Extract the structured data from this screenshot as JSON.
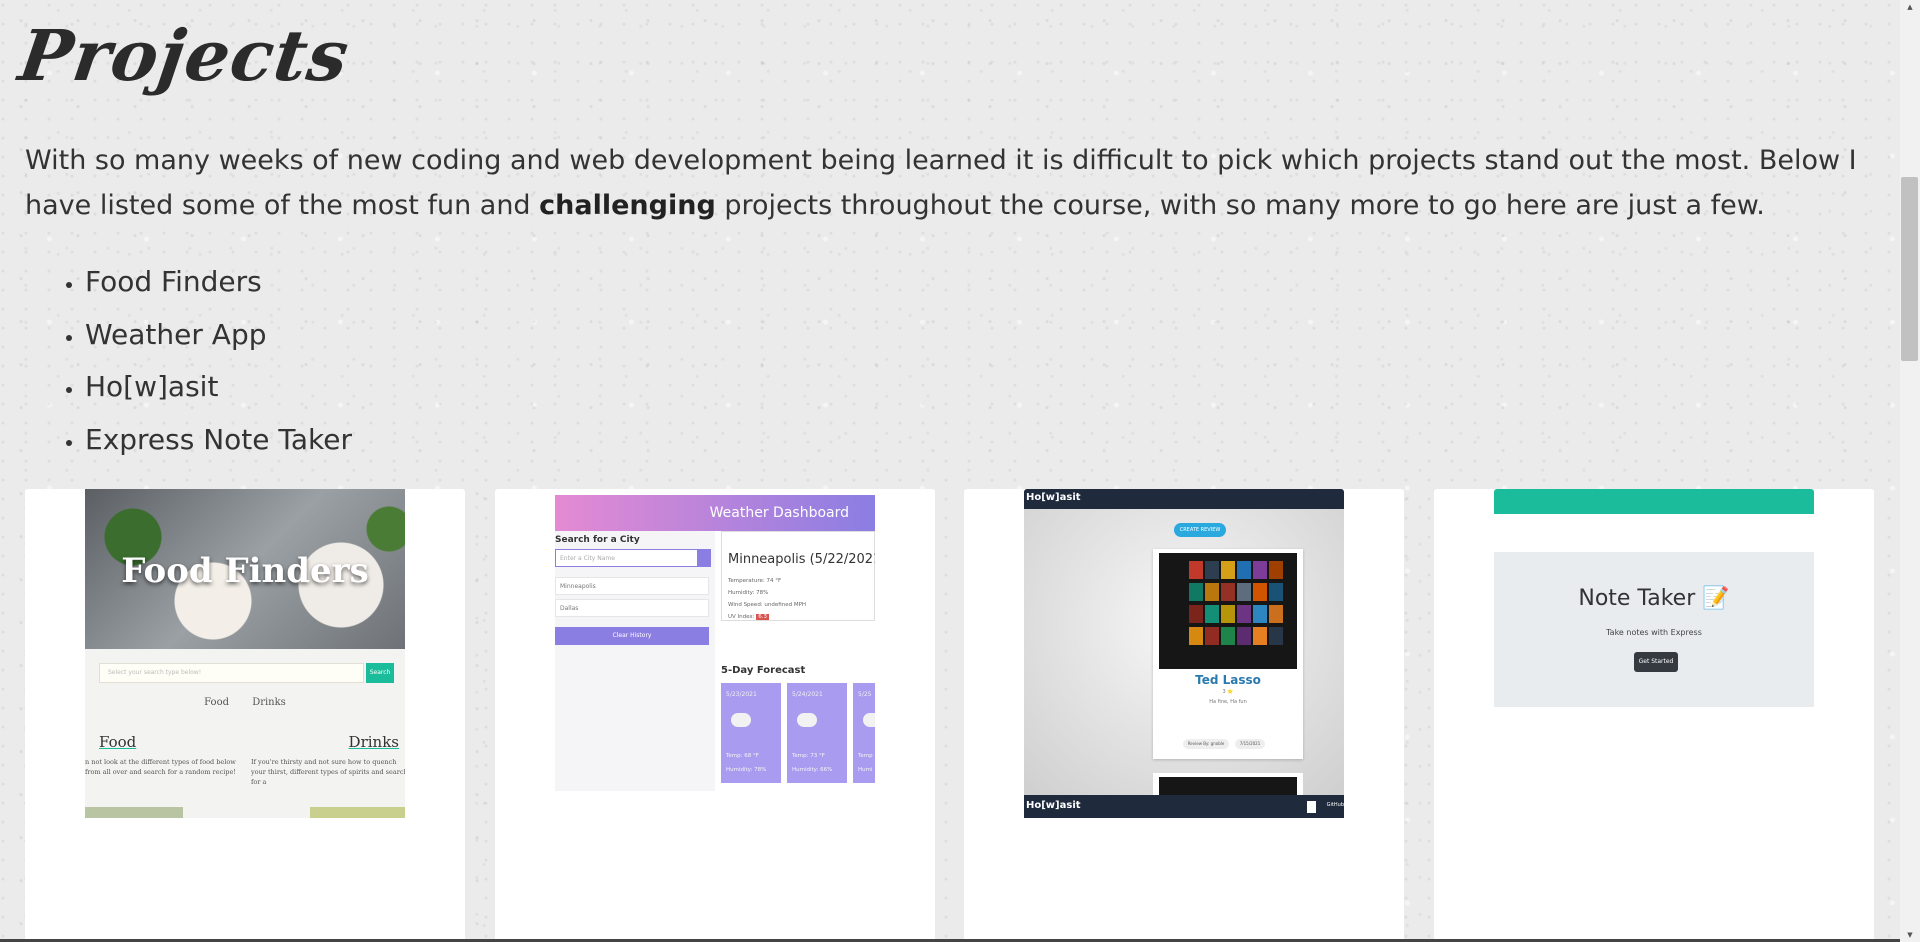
{
  "page": {
    "title": "Projects",
    "intro_before": "With so many weeks of new coding and web development being learned it is difficult to pick which projects stand out the most. Below I have listed some of the most fun and ",
    "intro_bold": "challenging",
    "intro_after": " projects throughout the course, with so many more to go here are just a few."
  },
  "projects": [
    "Food Finders",
    "Weather App",
    "Ho[w]asit",
    "Express Note Taker"
  ],
  "cards": {
    "food_finders": {
      "hero_title": "Food Finders",
      "search_placeholder": "Select your search type below!",
      "search_button": "Search",
      "nav_food": "Food",
      "nav_drinks": "Drinks",
      "col_food_title": "Food",
      "col_drinks_title": "Drinks",
      "col_food_text": "n not look at the different types of food below from all over and search for a random recipe!",
      "col_drinks_text": "If you're thirsty and not sure how to quench your thirst, different types of spirits and search for a"
    },
    "weather": {
      "header": "Weather Dashboard",
      "search_label": "Search for a City",
      "input_placeholder": "Enter a City Name",
      "city_1": "Minneapolis",
      "city_2": "Dallas",
      "clear_button": "Clear History",
      "current_title": "Minneapolis (5/22/2021)",
      "temperature": "Temperature: 74 °F",
      "humidity": "Humidity: 78%",
      "wind": "Wind Speed: undefined MPH",
      "uv_label": "UV Index:",
      "uv_value": "6.3",
      "forecast_title": "5-Day Forecast",
      "fc_1_date": "5/23/2021",
      "fc_1_temp": "Temp: 68 °F",
      "fc_1_hum": "Humidity: 78%",
      "fc_2_date": "5/24/2021",
      "fc_2_temp": "Temp: 73 °F",
      "fc_2_hum": "Humidity: 66%",
      "fc_3_date": "5/25",
      "fc_3_temp": "Temp",
      "fc_3_hum": "Humi"
    },
    "howasit": {
      "top_title": "Ho[w]asit",
      "create_button": "CREATE REVIEW",
      "show_title": "Ted Lasso",
      "show_rating": "3 ⭐",
      "show_sub": "Ha fine, Ha fun",
      "tag_1": "Review By: gnoble",
      "tag_2": "7/15/2021",
      "bottom_title": "Ho[w]asit",
      "bottom_link": "GitHub"
    },
    "note_taker": {
      "title": "Note Taker 📝",
      "subtitle": "Take notes with Express",
      "button": "Get Started"
    }
  },
  "colors": {
    "teal": "#1bbc9b",
    "purple": "#8b7ee3",
    "navy": "#1f2a3d"
  }
}
